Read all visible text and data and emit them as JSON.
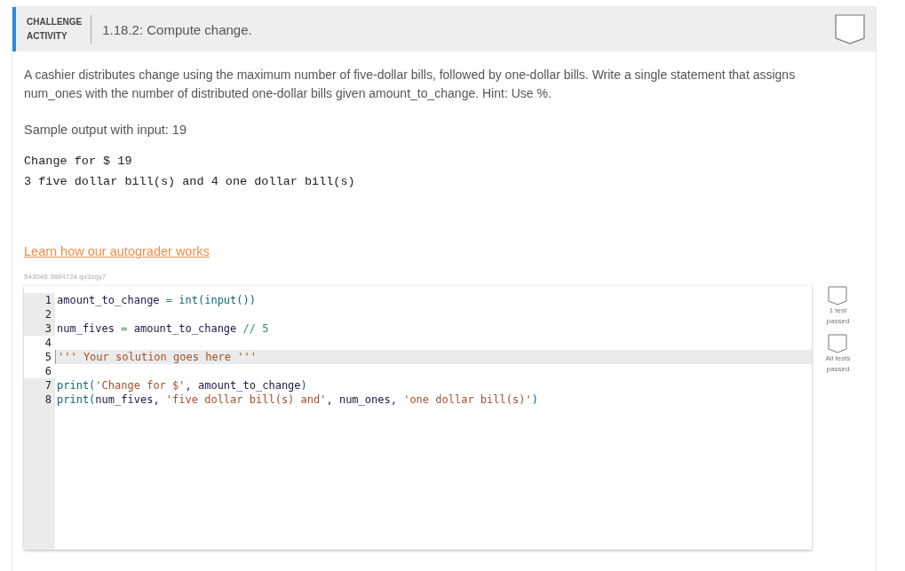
{
  "header": {
    "kind_label_1": "CHALLENGE",
    "kind_label_2": "ACTIVITY",
    "title": "1.18.2: Compute change.",
    "completed": false
  },
  "instructions": "A cashier distributes change using the maximum number of five-dollar bills, followed by one-dollar bills. Write a single statement that assigns num_ones with the number of distributed one-dollar bills given amount_to_change. Hint: Use %.",
  "sample_label": "Sample output with input: 19",
  "sample_output": [
    "Change for $ 19",
    "3 five dollar bill(s) and 4 one dollar bill(s)"
  ],
  "autograder_link": "Learn how our autograder works",
  "session_id": "543046.3884724.qx3zqy7",
  "code_lines": [
    {
      "number": "1",
      "editable": false,
      "active": false,
      "tokens": [
        {
          "text": "amount_to_change ",
          "kind": "name"
        },
        {
          "text": "=",
          "kind": "op"
        },
        {
          "text": " int(input())",
          "kind": "builtin"
        }
      ]
    },
    {
      "number": "2",
      "editable": false,
      "active": false
    },
    {
      "number": "3",
      "editable": false,
      "active": false,
      "tokens": [
        {
          "text": "num_fives ",
          "kind": "name"
        },
        {
          "text": "=",
          "kind": "op"
        },
        {
          "text": " amount_to_change ",
          "kind": "name"
        },
        {
          "text": "//",
          "kind": "op"
        },
        {
          "text": " 5",
          "kind": "number"
        }
      ]
    },
    {
      "number": "4",
      "editable": true,
      "active": false
    },
    {
      "number": "5",
      "editable": true,
      "active": true,
      "tokens": [
        {
          "text": "''' Your solution goes here '''",
          "kind": "string"
        }
      ]
    },
    {
      "number": "6",
      "editable": true,
      "active": false
    },
    {
      "number": "7",
      "editable": false,
      "active": false,
      "tokens": [
        {
          "text": "print(",
          "kind": "builtin"
        },
        {
          "text": "'Change for $'",
          "kind": "string"
        },
        {
          "text": ", amount_to_change",
          "kind": "name"
        },
        {
          "text": ")",
          "kind": "builtin"
        }
      ]
    },
    {
      "number": "8",
      "editable": false,
      "active": false,
      "tokens": [
        {
          "text": "print(",
          "kind": "builtin"
        },
        {
          "text": "num_fives, ",
          "kind": "name"
        },
        {
          "text": "'five dollar bill(s) and'",
          "kind": "string"
        },
        {
          "text": ", num_ones, ",
          "kind": "name"
        },
        {
          "text": "'one dollar bill(s)'",
          "kind": "string"
        },
        {
          "text": ")",
          "kind": "builtin"
        }
      ]
    }
  ],
  "tests": [
    {
      "label": "1 test passed",
      "passed": false
    },
    {
      "label": "All tests passed",
      "passed": false
    }
  ]
}
